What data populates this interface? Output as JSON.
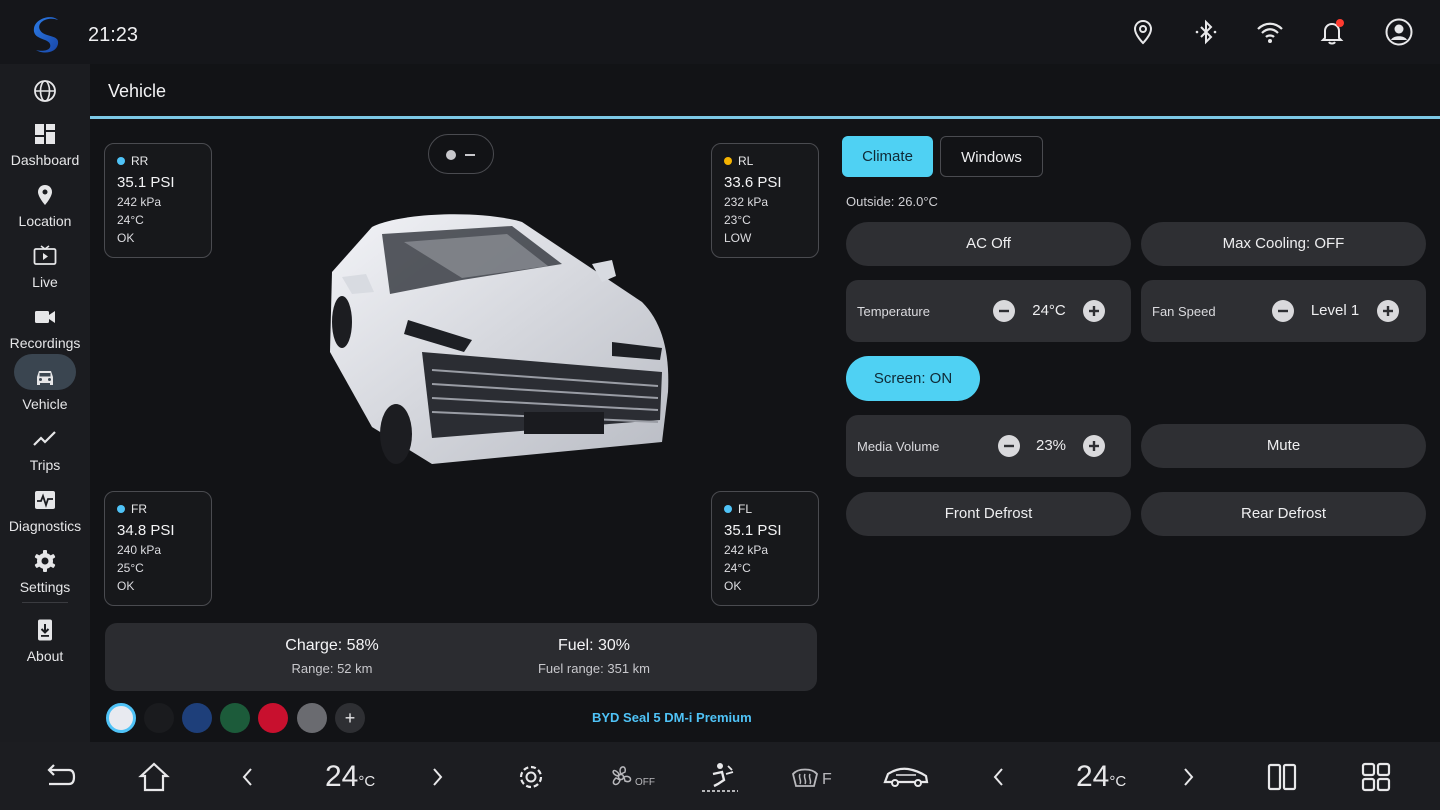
{
  "status_bar": {
    "time": "21:23",
    "icons": [
      "location-icon",
      "bluetooth-icon",
      "wifi-icon",
      "notification-bell-icon",
      "account-icon"
    ]
  },
  "sidebar": {
    "items": [
      {
        "label": "",
        "icon": "globe-icon"
      },
      {
        "label": "Dashboard",
        "icon": "dashboard-icon"
      },
      {
        "label": "Location",
        "icon": "location-pin-icon"
      },
      {
        "label": "Live",
        "icon": "tv-icon"
      },
      {
        "label": "Recordings",
        "icon": "camera-icon"
      },
      {
        "label": "Vehicle",
        "icon": "car-icon",
        "active": true
      },
      {
        "label": "Trips",
        "icon": "trend-icon"
      },
      {
        "label": "Diagnostics",
        "icon": "pulse-icon"
      },
      {
        "label": "Settings",
        "icon": "gear-icon"
      },
      {
        "label": "About",
        "icon": "download-phone-icon"
      }
    ]
  },
  "page": {
    "title": "Vehicle"
  },
  "tires": {
    "rr": {
      "pos": "RR",
      "psi": "35.1 PSI",
      "kpa": "242 kPa",
      "temp": "24°C",
      "status": "OK",
      "color": "#4fc3f7"
    },
    "rl": {
      "pos": "RL",
      "psi": "33.6 PSI",
      "kpa": "232 kPa",
      "temp": "23°C",
      "status": "LOW",
      "color": "#f5b301"
    },
    "fr": {
      "pos": "FR",
      "psi": "34.8 PSI",
      "kpa": "240 kPa",
      "temp": "25°C",
      "status": "OK",
      "color": "#4fc3f7"
    },
    "fl": {
      "pos": "FL",
      "psi": "35.1 PSI",
      "kpa": "242 kPa",
      "temp": "24°C",
      "status": "OK",
      "color": "#4fc3f7"
    }
  },
  "energy": {
    "charge": "Charge: 58%",
    "range": "Range: 52 km",
    "fuel": "Fuel: 30%",
    "fuel_range": "Fuel range: 351 km"
  },
  "colors": {
    "swatches": [
      "#e8eaf0",
      "#1a1b1e",
      "#1e3f7a",
      "#1c5b3a",
      "#c8102e",
      "#6a6b70"
    ],
    "add_label": "+"
  },
  "model": {
    "name": "BYD Seal 5 DM-i Premium"
  },
  "tabs": {
    "climate": "Climate",
    "windows": "Windows"
  },
  "climate": {
    "outside": "Outside: 26.0°C",
    "ac": "AC Off",
    "max_cooling": "Max Cooling: OFF",
    "temperature_label": "Temperature",
    "temperature_value": "24°C",
    "fan_label": "Fan Speed",
    "fan_value": "Level 1",
    "screen": "Screen: ON",
    "volume_label": "Media Volume",
    "volume_value": "23%",
    "mute": "Mute",
    "front_defrost": "Front Defrost",
    "rear_defrost": "Rear Defrost"
  },
  "dock": {
    "left_temp": "24",
    "right_temp": "24",
    "unit": "°C",
    "fan_state": "OFF",
    "defrost_label": "F"
  },
  "accent": "#4fd1f3"
}
